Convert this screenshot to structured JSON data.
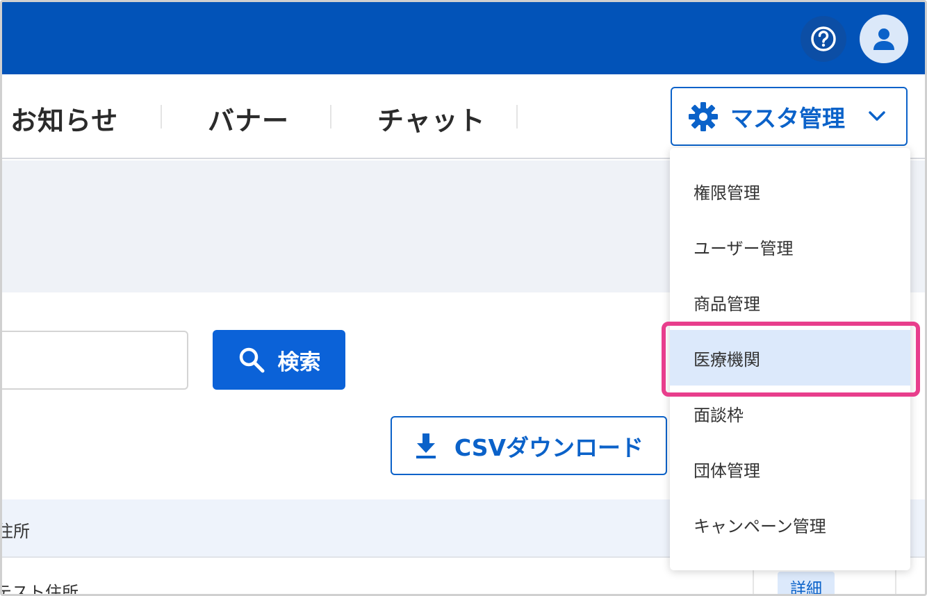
{
  "topbar": {
    "background": "#0253b8",
    "help_icon": "help-circle-icon",
    "avatar_icon": "user-icon"
  },
  "nav": {
    "items": [
      {
        "label": "お知らせ"
      },
      {
        "label": "バナー"
      },
      {
        "label": "チャット"
      }
    ],
    "master": {
      "label": "マスタ管理",
      "icon": "gear-icon",
      "chevron": "chevron-down-icon"
    }
  },
  "dropdown": {
    "items": [
      {
        "label": "権限管理"
      },
      {
        "label": "ユーザー管理"
      },
      {
        "label": "商品管理"
      },
      {
        "label": "医療機関",
        "active": true
      },
      {
        "label": "面談枠"
      },
      {
        "label": "団体管理"
      },
      {
        "label": "キャンペーン管理"
      }
    ],
    "highlight_color": "#e83e8c"
  },
  "search": {
    "input_value": "",
    "button_label": "検索",
    "button_icon": "search-icon"
  },
  "csv": {
    "label": "CSVダウンロード",
    "icon": "download-icon"
  },
  "table": {
    "header_partial": "住所",
    "row_partial": "テスト住所",
    "detail_label": "詳細"
  },
  "colors": {
    "accent": "#0b62c9",
    "primary_button": "#0b62d8",
    "band": "#eff2f7",
    "active_item": "#dce9fb"
  }
}
